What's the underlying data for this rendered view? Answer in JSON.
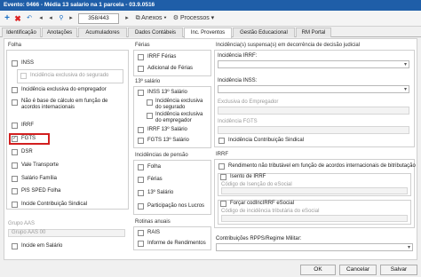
{
  "window": {
    "title": "Evento: 0466 - Média 13 salario na 1 parcela - 03.9.0516"
  },
  "toolbar": {
    "add_icon": "plus-icon",
    "delete_icon": "x-icon",
    "undo_icon": "undo-icon",
    "search_icon": "search-icon",
    "nav_icon": "arrow-icon",
    "record": "358/443",
    "anexos": "Anexos",
    "processos": "Processos"
  },
  "tabs": [
    "Identificação",
    "Anotações",
    "Acumuladores",
    "Dados Contábeis",
    "Inc. Proventos",
    "Gestão Educacional",
    "RM Portal"
  ],
  "active_tab": "Inc. Proventos",
  "col1": {
    "folha": {
      "title": "Folha",
      "inss": "INSS",
      "inss_seg": "Incidência exclusiva do segurado",
      "inss_emp": "Incidência exclusiva do empregador",
      "nao_base": "Não é base de cálculo em função de acordos internacionais",
      "irrf": "IRRF",
      "fgts": "FGTS",
      "dsr": "DSR",
      "vale": "Vale Transporte",
      "salfam": "Salário Família",
      "pis": "PIS SPED Folha",
      "incide": "Incide Contribuição Sindical"
    },
    "aas": {
      "title": "Grupo AAS",
      "label": "Grupo AAS 00",
      "incide_abono": "Incide em Salário"
    }
  },
  "col2": {
    "ferias": {
      "title": "Férias",
      "irrf": "IRRF Férias",
      "adic": "Adicional de Férias"
    },
    "decimo": {
      "title": "13º salário",
      "inss": "INSS 13º Salário",
      "seg": "Incidência exclusiva do segurado",
      "emp": "Incidência exclusiva do empregador",
      "irrf": "IRRF 13º Salário",
      "fgts": "FGTS 13º Salário"
    },
    "pensao": {
      "title": "Incidências de pensão",
      "folha": "Folha",
      "ferias": "Férias",
      "decimo": "13º Salário",
      "part": "Participação nos Lucros"
    },
    "rotinas": {
      "title": "Rotinas anuais",
      "rais": "RAIS",
      "inf": "Informe de Rendimentos"
    }
  },
  "col3": {
    "susp": {
      "title": "Incidência(s) suspensa(s) em decorrência de decisão judicial",
      "irrf": "Incidência IRRF:",
      "inss": "Incidência INSS:",
      "emp": "Exclusiva do Empregador",
      "fgts": "Incidência FGTS",
      "sindical": "Incidência Contribuição Sindical"
    },
    "irrf": {
      "title": "IRRF",
      "rend": "Rendimento não tributável em função de acordos internacionais de bitributação",
      "isento": "Isento de IRRF",
      "cod_isencao": "Código de Isenção do eSocial",
      "forcar": "Forçar codIncIRRF eSocial",
      "cod_inc": "Código de incidência tributária do eSocial"
    },
    "rpps": {
      "title": "Contribuições RPPS/Regime Militar:"
    }
  },
  "footer": {
    "ok": "OK",
    "cancel": "Cancelar",
    "save": "Salvar"
  }
}
